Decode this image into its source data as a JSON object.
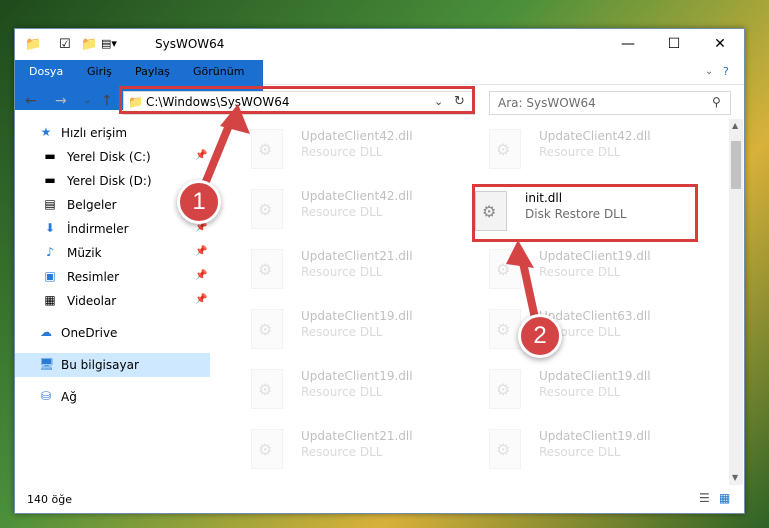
{
  "window": {
    "title": "SysWOW64"
  },
  "ribbon": {
    "tabs": [
      "Dosya",
      "Giriş",
      "Paylaş",
      "Görünüm"
    ]
  },
  "address": {
    "path": "C:\\Windows\\SysWOW64"
  },
  "search": {
    "placeholder": "Ara: SysWOW64"
  },
  "nav": {
    "items": [
      {
        "label": "Hızlı erişim",
        "icon": "star-icon"
      },
      {
        "label": "Yerel Disk (C:)",
        "icon": "drive-icon"
      },
      {
        "label": "Yerel Disk (D:)",
        "icon": "drive-icon"
      },
      {
        "label": "Belgeler",
        "icon": "document-icon"
      },
      {
        "label": "İndirmeler",
        "icon": "download-icon"
      },
      {
        "label": "Müzik",
        "icon": "music-icon"
      },
      {
        "label": "Resimler",
        "icon": "pictures-icon"
      },
      {
        "label": "Videolar",
        "icon": "video-icon"
      },
      {
        "label": "OneDrive",
        "icon": "cloud-icon"
      },
      {
        "label": "Bu bilgisayar",
        "icon": "computer-icon"
      },
      {
        "label": "Ağ",
        "icon": "network-icon"
      }
    ]
  },
  "files": [
    {
      "name": "UpdateClient42.dll",
      "desc": "Resource DLL"
    },
    {
      "name": "UpdateClient42.dll",
      "desc": "Resource DLL"
    },
    {
      "name": "UpdateClient42.dll",
      "desc": "Resource DLL"
    },
    {
      "name": "init.dll",
      "desc": "Disk Restore DLL"
    },
    {
      "name": "UpdateClient21.dll",
      "desc": "Resource DLL"
    },
    {
      "name": "UpdateClient19.dll",
      "desc": "Resource DLL"
    },
    {
      "name": "UpdateClient19.dll",
      "desc": "Resource DLL"
    },
    {
      "name": "UpdateClient63.dll",
      "desc": "Resource DLL"
    },
    {
      "name": "UpdateClient19.dll",
      "desc": "Resource DLL"
    },
    {
      "name": "UpdateClient19.dll",
      "desc": "Resource DLL"
    },
    {
      "name": "UpdateClient21.dll",
      "desc": "Resource DLL"
    },
    {
      "name": "UpdateClient19.dll",
      "desc": "Resource DLL"
    }
  ],
  "status": {
    "count": "140 öğe"
  },
  "callouts": {
    "one": "1",
    "two": "2"
  },
  "colors": {
    "accent": "#1a6fd1",
    "highlight": "#d83b3b",
    "selection": "#cde8ff"
  }
}
